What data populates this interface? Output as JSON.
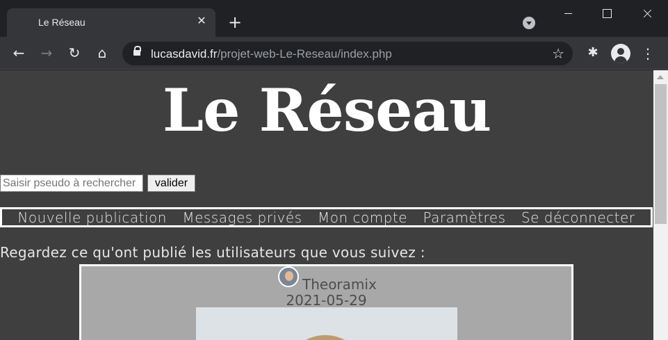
{
  "browser": {
    "tab_title": "Le Réseau",
    "tab_close": "✕",
    "new_tab": "+",
    "url_host": "lucasdavid.fr",
    "url_path": "/projet-web-Le-Reseau/index.php",
    "icons": {
      "back": "←",
      "forward": "→",
      "reload": "↻",
      "home": "⌂",
      "star": "☆",
      "extensions": "✱",
      "menu": "⋮"
    }
  },
  "site": {
    "title": "Le Réseau",
    "search": {
      "placeholder": "Saisir pseudo à rechercher",
      "button": "valider"
    },
    "nav": [
      {
        "label": "Nouvelle publication"
      },
      {
        "label": "Messages privés"
      },
      {
        "label": "Mon compte"
      },
      {
        "label": "Paramètres"
      },
      {
        "label": "Se déconnecter"
      }
    ],
    "feed_intro": "Regardez ce qu'ont publié les utilisateurs que vous suivez :",
    "post": {
      "author": "Theoramix",
      "date": "2021-05-29"
    }
  },
  "colors": {
    "page_bg": "#3f3f3f",
    "post_bg": "#a8a8a8",
    "chrome_dark": "#202124",
    "chrome_toolbar": "#35363a"
  }
}
